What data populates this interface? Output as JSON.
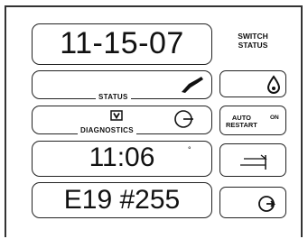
{
  "date": "11-15-07",
  "time": "11:06",
  "error_code": "E19 #255",
  "status_label": "STATUS",
  "diagnostics_label": "DIAGNOSTICS",
  "switch_status_label": "SWITCH STATUS",
  "auto_restart_label": "AUTO RESTART",
  "auto_restart_state": "ON",
  "icons": {
    "status": "valve-handle-icon",
    "diagnostics_box": "boxed-v-icon",
    "diagnostics_gauge": "gauge-icon",
    "time_degree": "degree-mark",
    "drop": "water-drop-icon",
    "transfer": "transfer-arrows-icon",
    "rotate": "rotate-arrow-icon"
  }
}
